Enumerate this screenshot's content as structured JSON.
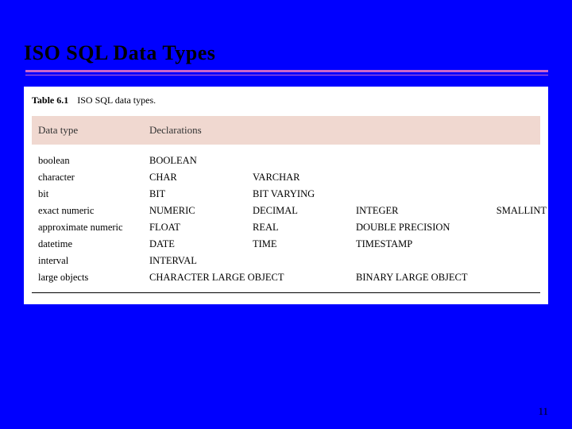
{
  "slide": {
    "title": "ISO SQL Data Types",
    "page_number": "11"
  },
  "table": {
    "caption_label": "Table 6.1",
    "caption_text": "ISO SQL data types.",
    "header": {
      "type_col": "Data type",
      "decl_col": "Declarations"
    },
    "rows": [
      {
        "type": "boolean",
        "decls": [
          "BOOLEAN"
        ]
      },
      {
        "type": "character",
        "decls": [
          "CHAR",
          "VARCHAR"
        ]
      },
      {
        "type": "bit",
        "decls": [
          "BIT",
          "BIT VARYING"
        ]
      },
      {
        "type": "exact numeric",
        "decls": [
          "NUMERIC",
          "DECIMAL",
          "INTEGER",
          "SMALLINT"
        ]
      },
      {
        "type": "approximate numeric",
        "decls": [
          "FLOAT",
          "REAL",
          "DOUBLE PRECISION"
        ]
      },
      {
        "type": "datetime",
        "decls": [
          "DATE",
          "TIME",
          "TIMESTAMP"
        ]
      },
      {
        "type": "interval",
        "decls": [
          "INTERVAL"
        ]
      },
      {
        "type": "large objects",
        "decls": [
          "CHARACTER LARGE OBJECT",
          "",
          "BINARY LARGE OBJECT"
        ]
      }
    ]
  }
}
